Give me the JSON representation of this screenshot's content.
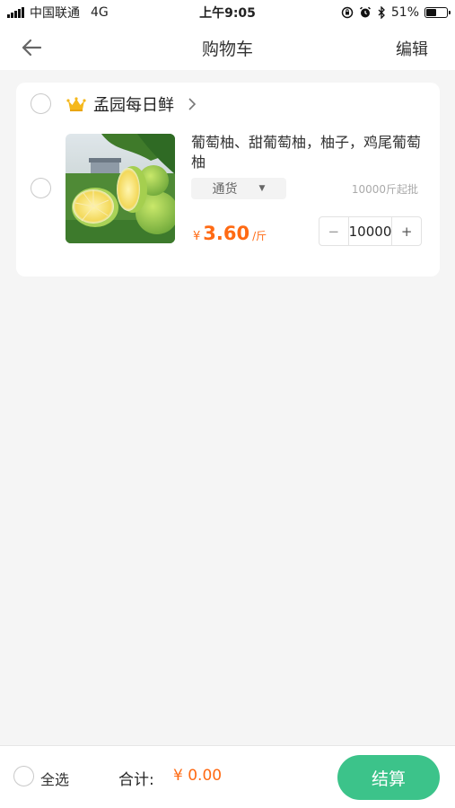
{
  "status_bar": {
    "carrier": "中国联通",
    "network": "4G",
    "time": "上午9:05",
    "battery": "51%",
    "battery_level": 0.51
  },
  "nav": {
    "title": "购物车",
    "edit_label": "编辑",
    "back_icon": "arrow-left-icon"
  },
  "shop": {
    "name": "孟园每日鲜",
    "crown_icon": "crown-icon",
    "items": [
      {
        "title": "葡萄柚、甜葡萄柚，柚子，鸡尾葡萄柚",
        "spec": "通货",
        "min_order": "10000斤起批",
        "currency": "¥",
        "price": "3.60",
        "unit": "/斤",
        "quantity": "10000",
        "minus": "−",
        "plus": "+"
      }
    ]
  },
  "footer": {
    "select_all_label": "全选",
    "total_label": "合计:",
    "total_value": "¥ 0.00",
    "checkout_label": "结算"
  },
  "colors": {
    "accent": "#ff6a13",
    "checkout": "#3cc38a",
    "background": "#f5f5f5"
  }
}
